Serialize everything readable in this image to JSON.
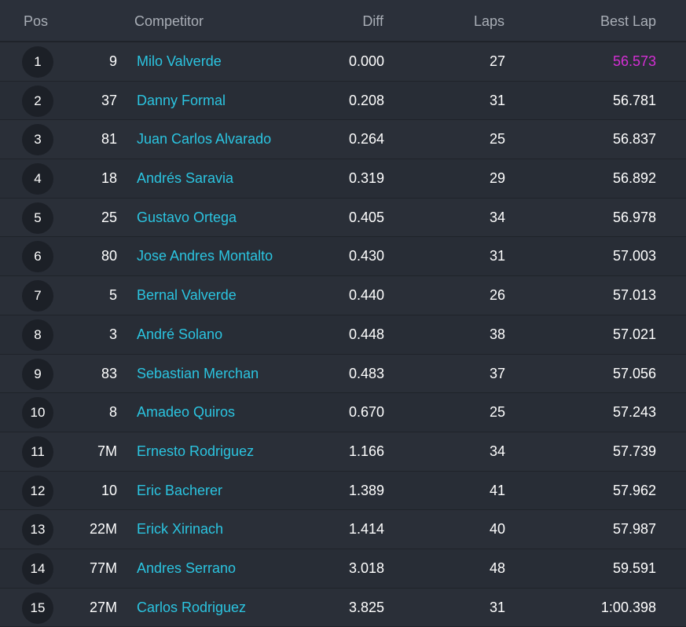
{
  "header": {
    "pos": "Pos",
    "competitor": "Competitor",
    "diff": "Diff",
    "laps": "Laps",
    "best_lap": "Best Lap"
  },
  "colors": {
    "name": "#2bc4e0",
    "best_overall": "#d42fd4",
    "background": "#262b34"
  },
  "rows": [
    {
      "pos": "1",
      "number": "9",
      "name": "Milo Valverde",
      "diff": "0.000",
      "laps": "27",
      "best_lap": "56.573",
      "overall_best": true
    },
    {
      "pos": "2",
      "number": "37",
      "name": "Danny Formal",
      "diff": "0.208",
      "laps": "31",
      "best_lap": "56.781"
    },
    {
      "pos": "3",
      "number": "81",
      "name": "Juan Carlos Alvarado",
      "diff": "0.264",
      "laps": "25",
      "best_lap": "56.837"
    },
    {
      "pos": "4",
      "number": "18",
      "name": "Andrés Saravia",
      "diff": "0.319",
      "laps": "29",
      "best_lap": "56.892"
    },
    {
      "pos": "5",
      "number": "25",
      "name": "Gustavo Ortega",
      "diff": "0.405",
      "laps": "34",
      "best_lap": "56.978"
    },
    {
      "pos": "6",
      "number": "80",
      "name": "Jose Andres Montalto",
      "diff": "0.430",
      "laps": "31",
      "best_lap": "57.003"
    },
    {
      "pos": "7",
      "number": "5",
      "name": "Bernal Valverde",
      "diff": "0.440",
      "laps": "26",
      "best_lap": "57.013"
    },
    {
      "pos": "8",
      "number": "3",
      "name": "André Solano",
      "diff": "0.448",
      "laps": "38",
      "best_lap": "57.021"
    },
    {
      "pos": "9",
      "number": "83",
      "name": "Sebastian Merchan",
      "diff": "0.483",
      "laps": "37",
      "best_lap": "57.056"
    },
    {
      "pos": "10",
      "number": "8",
      "name": "Amadeo Quiros",
      "diff": "0.670",
      "laps": "25",
      "best_lap": "57.243"
    },
    {
      "pos": "11",
      "number": "7M",
      "name": "Ernesto Rodriguez",
      "diff": "1.166",
      "laps": "34",
      "best_lap": "57.739"
    },
    {
      "pos": "12",
      "number": "10",
      "name": "Eric Bacherer",
      "diff": "1.389",
      "laps": "41",
      "best_lap": "57.962"
    },
    {
      "pos": "13",
      "number": "22M",
      "name": "Erick Xirinach",
      "diff": "1.414",
      "laps": "40",
      "best_lap": "57.987"
    },
    {
      "pos": "14",
      "number": "77M",
      "name": "Andres Serrano",
      "diff": "3.018",
      "laps": "48",
      "best_lap": "59.591"
    },
    {
      "pos": "15",
      "number": "27M",
      "name": "Carlos Rodriguez",
      "diff": "3.825",
      "laps": "31",
      "best_lap": "1:00.398"
    }
  ]
}
